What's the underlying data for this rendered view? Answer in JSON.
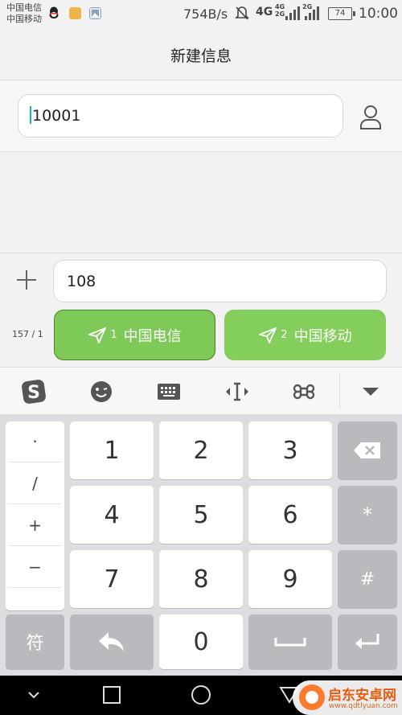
{
  "status_bar": {
    "carrier_1": "中国电信",
    "carrier_2": "中国移动",
    "net_speed": "754B/s",
    "network_1": "4G",
    "network_2_top": "4G",
    "network_2_bottom": "2G",
    "network_3": "2G",
    "battery": "74",
    "time": "10:00",
    "icons": [
      "qq-icon",
      "app-notification-icon",
      "image-notification-icon",
      "mute-icon",
      "signal-icon",
      "battery-icon"
    ]
  },
  "header": {
    "title": "新建信息"
  },
  "recipient": {
    "value": "10001",
    "contact_icon": "person-icon"
  },
  "composer": {
    "add_icon": "plus-icon",
    "message": "108",
    "counter": "157 / 1",
    "send_buttons": [
      {
        "sim": "1",
        "label": "中国电信"
      },
      {
        "sim": "2",
        "label": "中国移动"
      }
    ]
  },
  "keyboard_toolbar": {
    "icons": [
      "sogou-logo-icon",
      "emoji-icon",
      "keyboard-icon",
      "cursor-move-icon",
      "command-icon",
      "collapse-icon"
    ]
  },
  "keyboard": {
    "symbols": [
      "·",
      "/",
      "+",
      "−"
    ],
    "digits": [
      "1",
      "2",
      "3",
      "4",
      "5",
      "6",
      "7",
      "8",
      "9",
      "0"
    ],
    "star": "*",
    "hash": "#",
    "symbol_key": "符",
    "colors": {
      "key": "#ffffff",
      "function_key": "#b8babd",
      "background": "#dcdde0",
      "send_green": "#84cf5c"
    }
  },
  "watermark": {
    "name": "启东安卓网",
    "url": "www.qdtlyuan.com"
  }
}
